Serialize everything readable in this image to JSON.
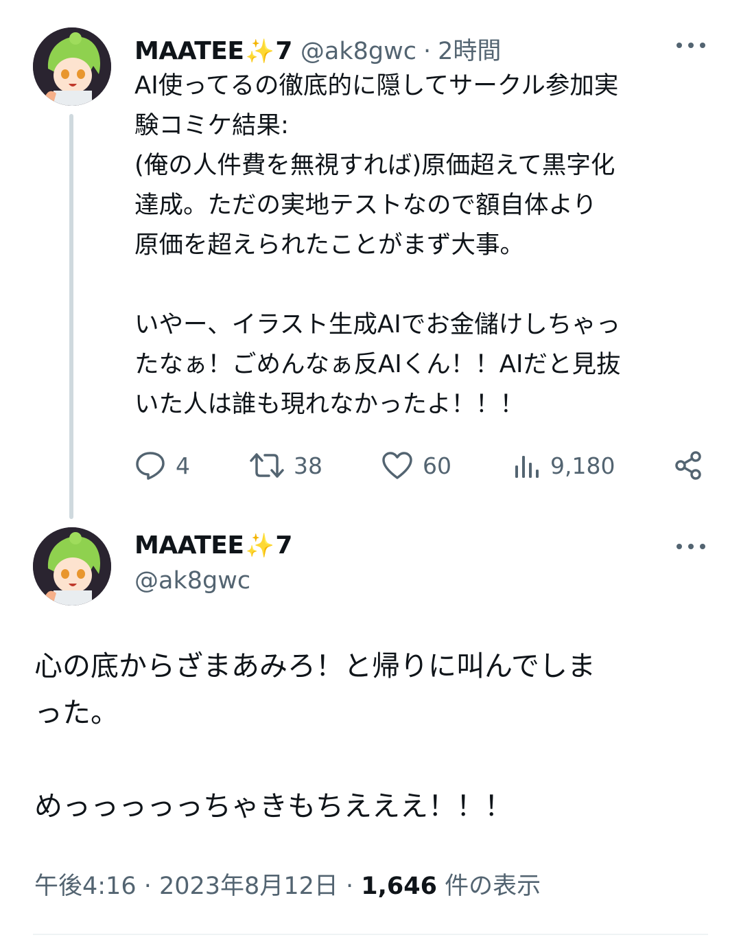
{
  "tweet1": {
    "display_name": "MAATEE",
    "name_emoji": "✨",
    "name_suffix": "7",
    "handle": "@ak8gwc",
    "separator": "·",
    "time": "2時間",
    "text": "AI使ってるの徹底的に隠してサークル参加実\n験コミケ結果:\n(俺の人件費を無視すれば)原価超えて黒字化\n達成。ただの実地テストなので額自体より\n原価を超えられたことがまず大事。\n\nいやー、イラスト生成AIでお金儲けしちゃっ\nたなぁ！ごめんなぁ反AIくん！！AIだと見抜\nいた人は誰も現れなかったよ！！！",
    "actions": {
      "replies": "4",
      "retweets": "38",
      "likes": "60",
      "views": "9,180"
    },
    "icons": [
      "reply-icon",
      "retweet-icon",
      "like-icon",
      "views-icon",
      "share-icon",
      "more-icon"
    ]
  },
  "tweet2": {
    "display_name": "MAATEE",
    "name_emoji": "✨",
    "name_suffix": "7",
    "handle": "@ak8gwc",
    "text": "心の底からざまあみろ！と帰りに叫んでしま\nった。\n\nめっっっっっちゃきもちえええ！！！",
    "timestamp": "午後4:16 · 2023年8月12日 · ",
    "view_count": "1,646",
    "view_label": " 件の表示"
  },
  "colors": {
    "text": "#0f1419",
    "secondary": "#536471",
    "thread_line": "#cfd9de",
    "sparkle": "#f4b400"
  }
}
